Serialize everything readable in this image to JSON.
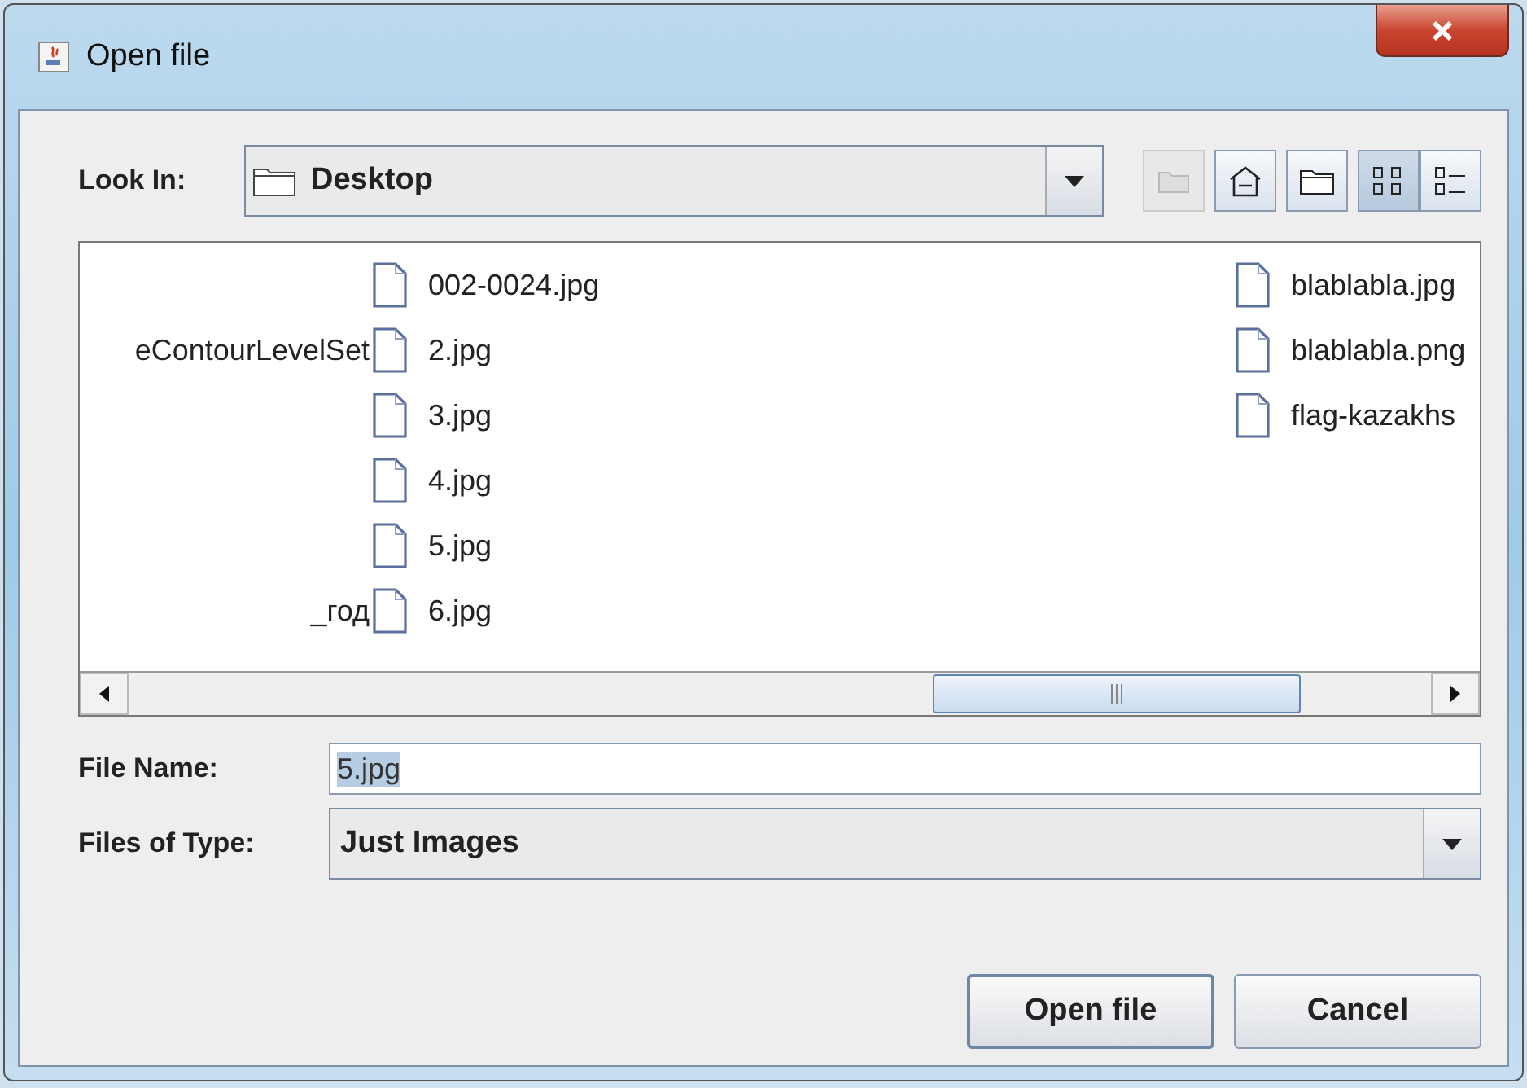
{
  "window": {
    "title": "Open file"
  },
  "look_in": {
    "label": "Look In:",
    "value": "Desktop"
  },
  "toolbar": [
    {
      "kind": "up",
      "disabled": true,
      "selected": false
    },
    {
      "kind": "home",
      "disabled": false,
      "selected": false
    },
    {
      "kind": "new-folder",
      "disabled": false,
      "selected": false
    },
    {
      "kind": "list",
      "disabled": false,
      "selected": true
    },
    {
      "kind": "details",
      "disabled": false,
      "selected": false
    }
  ],
  "file_list": {
    "columns": [
      {
        "items": [
          {
            "kind": "empty"
          },
          {
            "kind": "text",
            "name": "eContourLevelSet",
            "selected": false
          },
          {
            "kind": "empty"
          },
          {
            "kind": "empty"
          },
          {
            "kind": "empty"
          },
          {
            "kind": "text",
            "name": "_год",
            "selected": false
          }
        ]
      },
      {
        "items": [
          {
            "kind": "file",
            "name": "002-0024.jpg",
            "selected": false
          },
          {
            "kind": "file",
            "name": "2.jpg",
            "selected": false
          },
          {
            "kind": "file",
            "name": "3.jpg",
            "selected": false
          },
          {
            "kind": "file",
            "name": "4.jpg",
            "selected": false
          },
          {
            "kind": "file",
            "name": "5.jpg",
            "selected": false
          },
          {
            "kind": "file",
            "name": "6.jpg",
            "selected": false
          }
        ]
      },
      {
        "items": [
          {
            "kind": "file",
            "name": "blablabla.jpg",
            "selected": false
          },
          {
            "kind": "file",
            "name": "blablabla.png",
            "selected": false
          },
          {
            "kind": "file",
            "name": "flag-kazakhs",
            "selected": false
          }
        ]
      }
    ]
  },
  "file_name": {
    "label": "File Name:",
    "value": "5.jpg",
    "text_selected": true
  },
  "file_type": {
    "label": "Files of Type:",
    "value": "Just Images"
  },
  "buttons": [
    {
      "label": "Open file",
      "default": true
    },
    {
      "label": "Cancel",
      "default": false
    }
  ]
}
